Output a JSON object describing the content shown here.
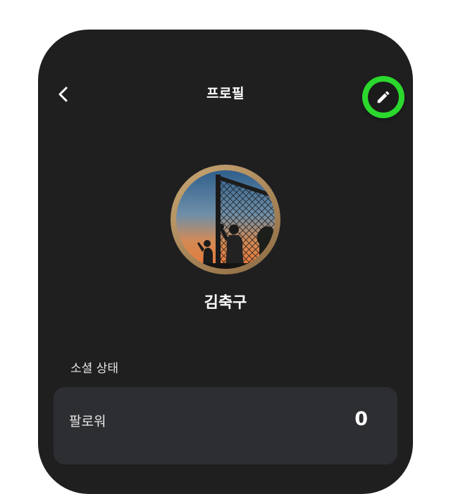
{
  "header": {
    "title": "프로필",
    "back_icon": "chevron-left-icon",
    "edit_icon": "pencil-icon"
  },
  "profile": {
    "name": "김축구",
    "avatar_description": "silhouette of goalkeeper at soccer goal at sunset"
  },
  "social": {
    "section_label": "소셜 상태",
    "followers_label": "팔로워",
    "followers_count": "0"
  },
  "colors": {
    "background": "#1f1f20",
    "card": "#2d2e31",
    "accent": "#2bd82d",
    "avatar_ring": "#b8925f"
  }
}
